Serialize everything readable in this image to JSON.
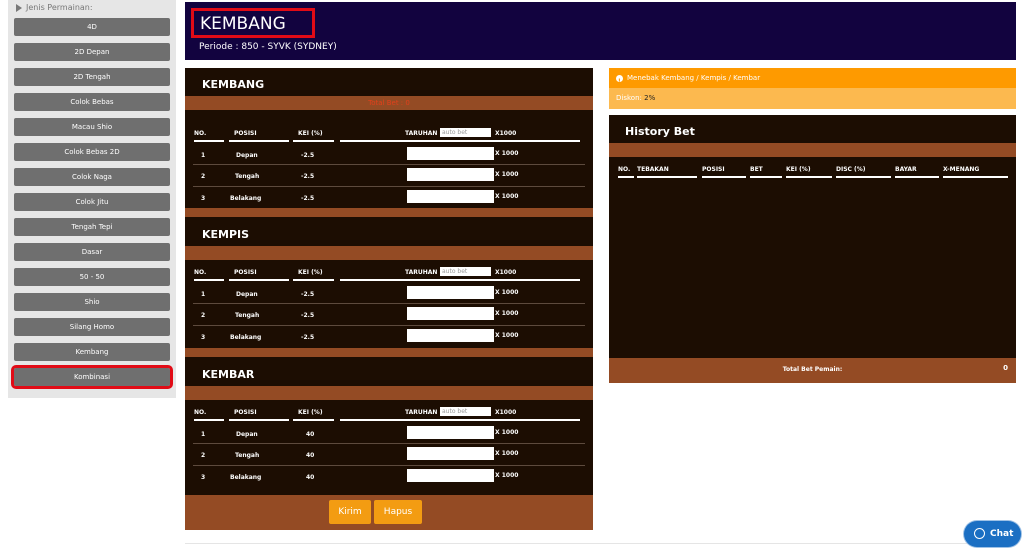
{
  "sidebar": {
    "heading": "Jenis Permainan:",
    "items": [
      {
        "label": "4D"
      },
      {
        "label": "2D Depan"
      },
      {
        "label": "2D Tengah"
      },
      {
        "label": "Colok Bebas"
      },
      {
        "label": "Macau Shio"
      },
      {
        "label": "Colok Bebas 2D"
      },
      {
        "label": "Colok Naga"
      },
      {
        "label": "Colok Jitu"
      },
      {
        "label": "Tengah Tepi"
      },
      {
        "label": "Dasar"
      },
      {
        "label": "50 - 50"
      },
      {
        "label": "Shio"
      },
      {
        "label": "Silang Homo"
      },
      {
        "label": "Kembang"
      },
      {
        "label": "Kombinasi"
      }
    ]
  },
  "header": {
    "title": "KEMBANG",
    "periode": "Periode : 850 - SYVK (SYDNEY)"
  },
  "sections": [
    {
      "title": "KEMBANG",
      "total_bet": "Total Bet : 0",
      "cols": {
        "no": "NO.",
        "posisi": "POSISI",
        "kei": "KEI (%)",
        "taruhan": "TARUHAN",
        "autobet": "auto bet",
        "mult": "X1000"
      },
      "rows": [
        {
          "no": "1",
          "posisi": "Depan",
          "kei": "-2.5",
          "mult": "X 1000"
        },
        {
          "no": "2",
          "posisi": "Tengah",
          "kei": "-2.5",
          "mult": "X 1000"
        },
        {
          "no": "3",
          "posisi": "Belakang",
          "kei": "-2.5",
          "mult": "X 1000"
        }
      ]
    },
    {
      "title": "KEMPIS",
      "cols": {
        "no": "NO.",
        "posisi": "POSISI",
        "kei": "KEI (%)",
        "taruhan": "TARUHAN",
        "autobet": "auto bet",
        "mult": "X1000"
      },
      "rows": [
        {
          "no": "1",
          "posisi": "Depan",
          "kei": "-2.5",
          "mult": "X 1000"
        },
        {
          "no": "2",
          "posisi": "Tengah",
          "kei": "-2.5",
          "mult": "X 1000"
        },
        {
          "no": "3",
          "posisi": "Belakang",
          "kei": "-2.5",
          "mult": "X 1000"
        }
      ]
    },
    {
      "title": "KEMBAR",
      "cols": {
        "no": "NO.",
        "posisi": "POSISI",
        "kei": "KEI (%)",
        "taruhan": "TARUHAN",
        "autobet": "auto bet",
        "mult": "X1000"
      },
      "rows": [
        {
          "no": "1",
          "posisi": "Depan",
          "kei": "40",
          "mult": "X 1000"
        },
        {
          "no": "2",
          "posisi": "Tengah",
          "kei": "40",
          "mult": "X 1000"
        },
        {
          "no": "3",
          "posisi": "Belakang",
          "kei": "40",
          "mult": "X 1000"
        }
      ]
    }
  ],
  "actions": {
    "kirim": "Kirim",
    "hapus": "Hapus"
  },
  "info": {
    "text": "Menebak Kembang / Kempis / Kembar",
    "diskon_label": "Diskon:",
    "diskon_value": "2%"
  },
  "history": {
    "title": "History Bet",
    "cols": [
      "NO.",
      "TEBAKAN",
      "POSISI",
      "BET",
      "KEI (%)",
      "DISC (%)",
      "BAYAR",
      "X-MENANG"
    ],
    "total_label": "Total Bet Pemain:",
    "total_value": "0"
  },
  "chat": {
    "label": "Chat"
  },
  "colors": {
    "header": "#12033f",
    "panel": "#1c0d02",
    "bar": "#944b24",
    "accent": "#f39c12",
    "active_outline": "#e10b16"
  }
}
